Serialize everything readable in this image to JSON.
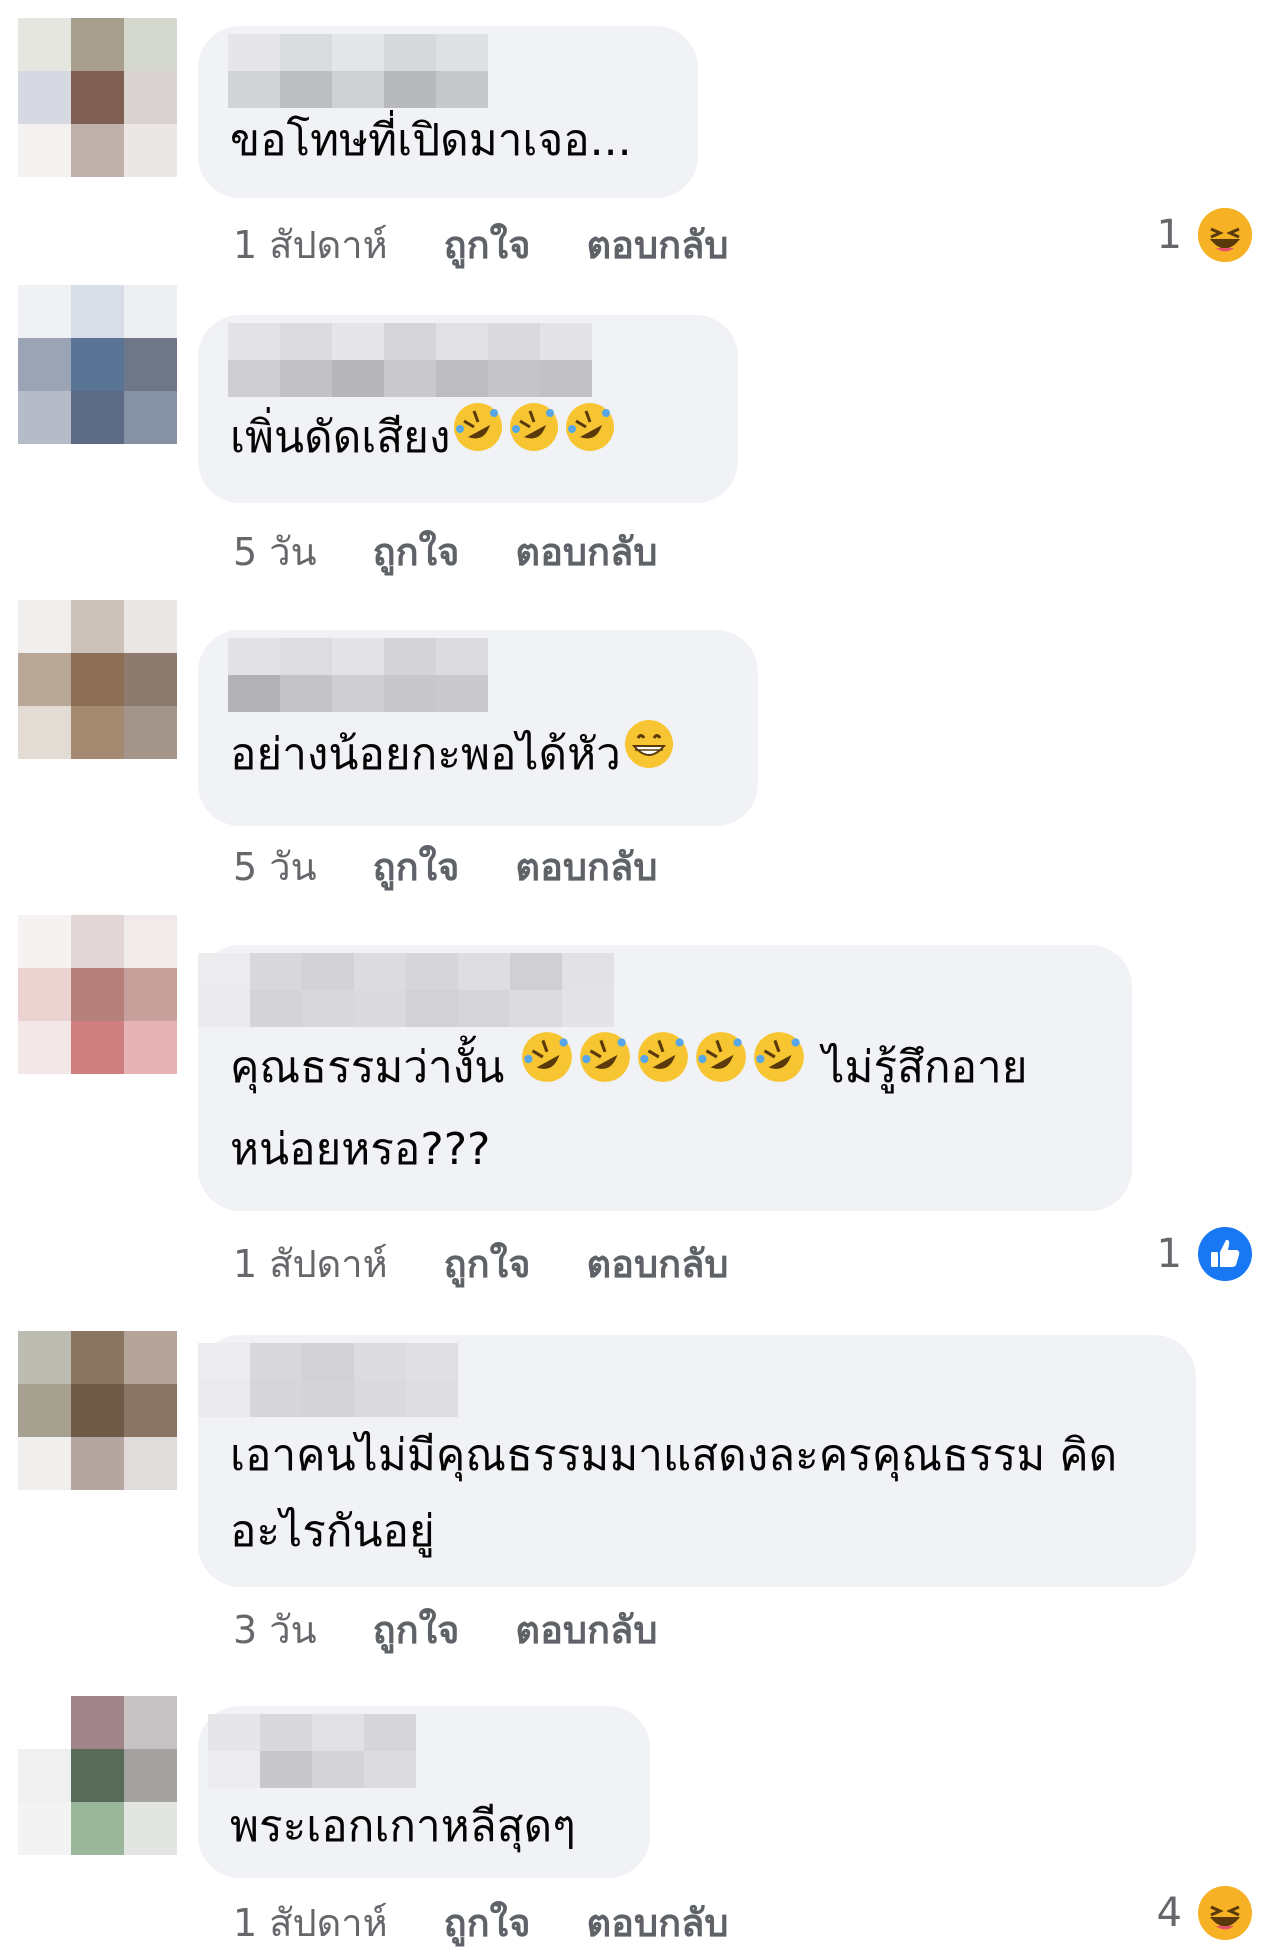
{
  "comments": [
    {
      "text": "ขอโทษที่เปิดมาเจอ...",
      "time": "1 สัปดาห์",
      "like_label": "ถูกใจ",
      "reply_label": "ตอบกลับ",
      "reaction_count": "1",
      "reaction": "haha-icon"
    },
    {
      "text": "เพิ่นดัดเสียง",
      "time": "5 วัน",
      "like_label": "ถูกใจ",
      "reply_label": "ตอบกลับ",
      "emojis": 3
    },
    {
      "text": "อย่างน้อยกะพอได้หัว",
      "time": "5 วัน",
      "like_label": "ถูกใจ",
      "reply_label": "ตอบกลับ"
    },
    {
      "text_line1": "คุณธรรมว่างั้น",
      "text_line1b": "ไม่รู้สึกอาย",
      "text_line2": "หน่อยหรอ???",
      "time": "1 สัปดาห์",
      "like_label": "ถูกใจ",
      "reply_label": "ตอบกลับ",
      "reaction_count": "1",
      "reaction": "like-icon",
      "emojis": 5
    },
    {
      "text_line1": "เอาคนไม่มีคุณธรรมมาแสดงละครคุณธรรม คิด",
      "text_line2": "อะไรกันอยู่",
      "time": "3 วัน",
      "like_label": "ถูกใจ",
      "reply_label": "ตอบกลับ"
    },
    {
      "text": "พระเอกเกาหลีสุดๆ",
      "time": "1 สัปดาห์",
      "like_label": "ถูกใจ",
      "reply_label": "ตอบกลับ",
      "reaction_count": "4",
      "reaction": "haha-icon"
    }
  ],
  "colors": {
    "bubble": "#f0f2f5",
    "meta": "#65676b",
    "like_blue": "#1877f2",
    "haha_yellow": "#f7b125"
  }
}
